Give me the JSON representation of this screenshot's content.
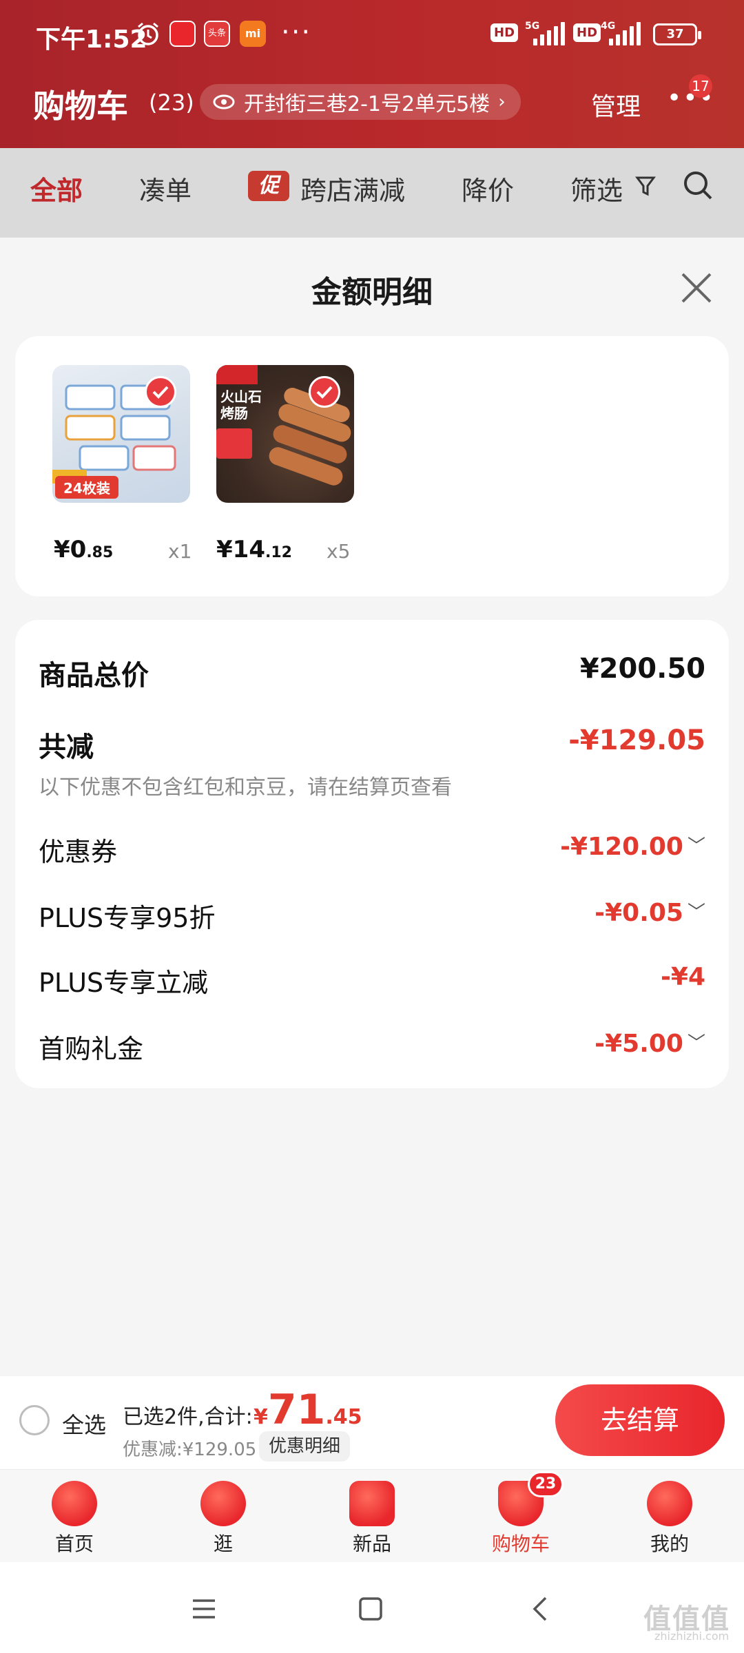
{
  "status_bar": {
    "time": "下午1:52",
    "net1": "5G",
    "net2": "4G",
    "hd": "HD",
    "battery": "37",
    "app_icon_1": "头条"
  },
  "header": {
    "title": "购物车",
    "count": "(23)",
    "address": "开封街三巷2-1号2单元5楼",
    "manage": "管理",
    "badge": "17"
  },
  "filters": {
    "items": [
      "全部",
      "凑单",
      "跨店满减",
      "降价",
      "筛选"
    ],
    "promo_tag": "促"
  },
  "sheet": {
    "title": "金额明细",
    "products": [
      {
        "price_int": "¥0",
        "price_dec": ".85",
        "qty": "x1",
        "image_caption": "24枚装"
      },
      {
        "price_int": "¥14",
        "price_dec": ".12",
        "qty": "x5",
        "image_caption": "火山石烤肠"
      }
    ],
    "total_label": "商品总价",
    "total_value": "¥200.50",
    "reduce_label": "共减",
    "reduce_value": "-¥129.05",
    "note": "以下优惠不包含红包和京豆，请在结算页查看",
    "discounts": [
      {
        "label": "优惠券",
        "value": "-¥120.00",
        "expandable": true
      },
      {
        "label": "PLUS专享95折",
        "value": "-¥0.05",
        "expandable": true
      },
      {
        "label": "PLUS专享立减",
        "value": "-¥4",
        "expandable": false
      },
      {
        "label": "首购礼金",
        "value": "-¥5.00",
        "expandable": true
      }
    ]
  },
  "checkout": {
    "select_all": "全选",
    "selected_text": "已选2件,合计:",
    "total_currency": "¥",
    "total_int": "71",
    "total_dec": ".45",
    "discount_text": "优惠减:¥129.05",
    "detail_button": "优惠明细",
    "pay_button": "去结算"
  },
  "tabbar": {
    "items": [
      {
        "label": "首页",
        "icon": "home-icon"
      },
      {
        "label": "逛",
        "icon": "browse-icon"
      },
      {
        "label": "新品",
        "icon": "new-icon"
      },
      {
        "label": "购物车",
        "icon": "cart-icon"
      },
      {
        "label": "我的",
        "icon": "profile-icon"
      }
    ],
    "cart_badge": "23"
  },
  "watermark": {
    "main": "值值值",
    "sub": "zhizhizhi.com"
  },
  "colors": {
    "accent": "#e23a2e",
    "brand_bar": "#b9292b"
  }
}
